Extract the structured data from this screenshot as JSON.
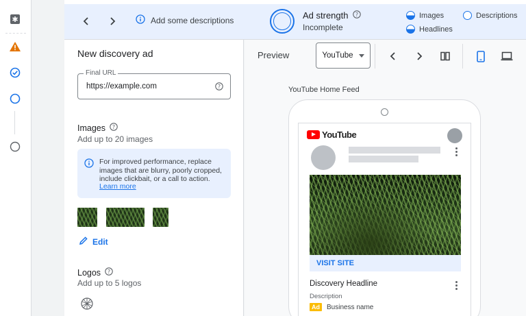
{
  "topbar": {
    "description_hint": "Add some descriptions",
    "ad_strength": {
      "title": "Ad strength",
      "status": "Incomplete"
    },
    "checklist": [
      {
        "label": "Images",
        "state": "partial"
      },
      {
        "label": "Descriptions",
        "state": "empty"
      },
      {
        "label": "Headlines",
        "state": "partial"
      }
    ]
  },
  "form": {
    "title": "New discovery ad",
    "final_url": {
      "label": "Final URL",
      "value": "https://example.com"
    },
    "images": {
      "title": "Images",
      "subtitle": "Add up to 20 images",
      "info_text": "For improved performance, replace images that are blurry, poorly cropped, include clickbait, or a call to action.",
      "info_link": "Learn more",
      "edit_label": "Edit"
    },
    "logos": {
      "title": "Logos",
      "subtitle": "Add up to 5 logos"
    }
  },
  "preview": {
    "title": "Preview",
    "platform": "YouTube",
    "feed_label": "YouTube Home Feed",
    "ad": {
      "brand": "YouTube",
      "cta": "VISIT SITE",
      "headline": "Discovery Headline",
      "description": "Description",
      "badge": "Ad",
      "business_name": "Business name"
    }
  },
  "colors": {
    "accent": "#1a73e8",
    "warning": "#e37400",
    "banner_bg": "#e8f0fe",
    "youtube_red": "#ff0000",
    "ad_badge": "#fbbc04"
  }
}
